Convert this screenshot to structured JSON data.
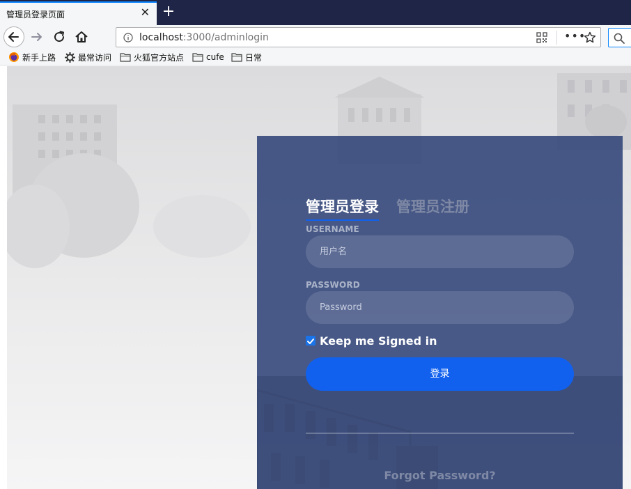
{
  "browser": {
    "tab": {
      "title": "管理员登录页面",
      "close_icon": "close-icon"
    },
    "new_tab_glyph": "+",
    "url": {
      "host": "localhost",
      "path": ":3000/adminlogin"
    },
    "bookmarks": [
      {
        "label": "新手上路",
        "icon": "firefox-icon"
      },
      {
        "label": "最常访问",
        "icon": "gear-icon"
      },
      {
        "label": "火狐官方站点",
        "icon": "folder-icon"
      },
      {
        "label": "cufe",
        "icon": "folder-icon"
      },
      {
        "label": "日常",
        "icon": "folder-icon"
      }
    ]
  },
  "login": {
    "tab_login": "管理员登录",
    "tab_register": "管理员注册",
    "username_label": "USERNAME",
    "username_placeholder": "用户名",
    "password_label": "PASSWORD",
    "password_placeholder": "Password",
    "remember_label": "Keep me Signed in",
    "remember_checked": true,
    "submit_label": "登录",
    "forgot_label": "Forgot Password?"
  },
  "colors": {
    "accent": "#1161ee",
    "panel": "#2c4076",
    "tabstrip": "#1f2547"
  }
}
